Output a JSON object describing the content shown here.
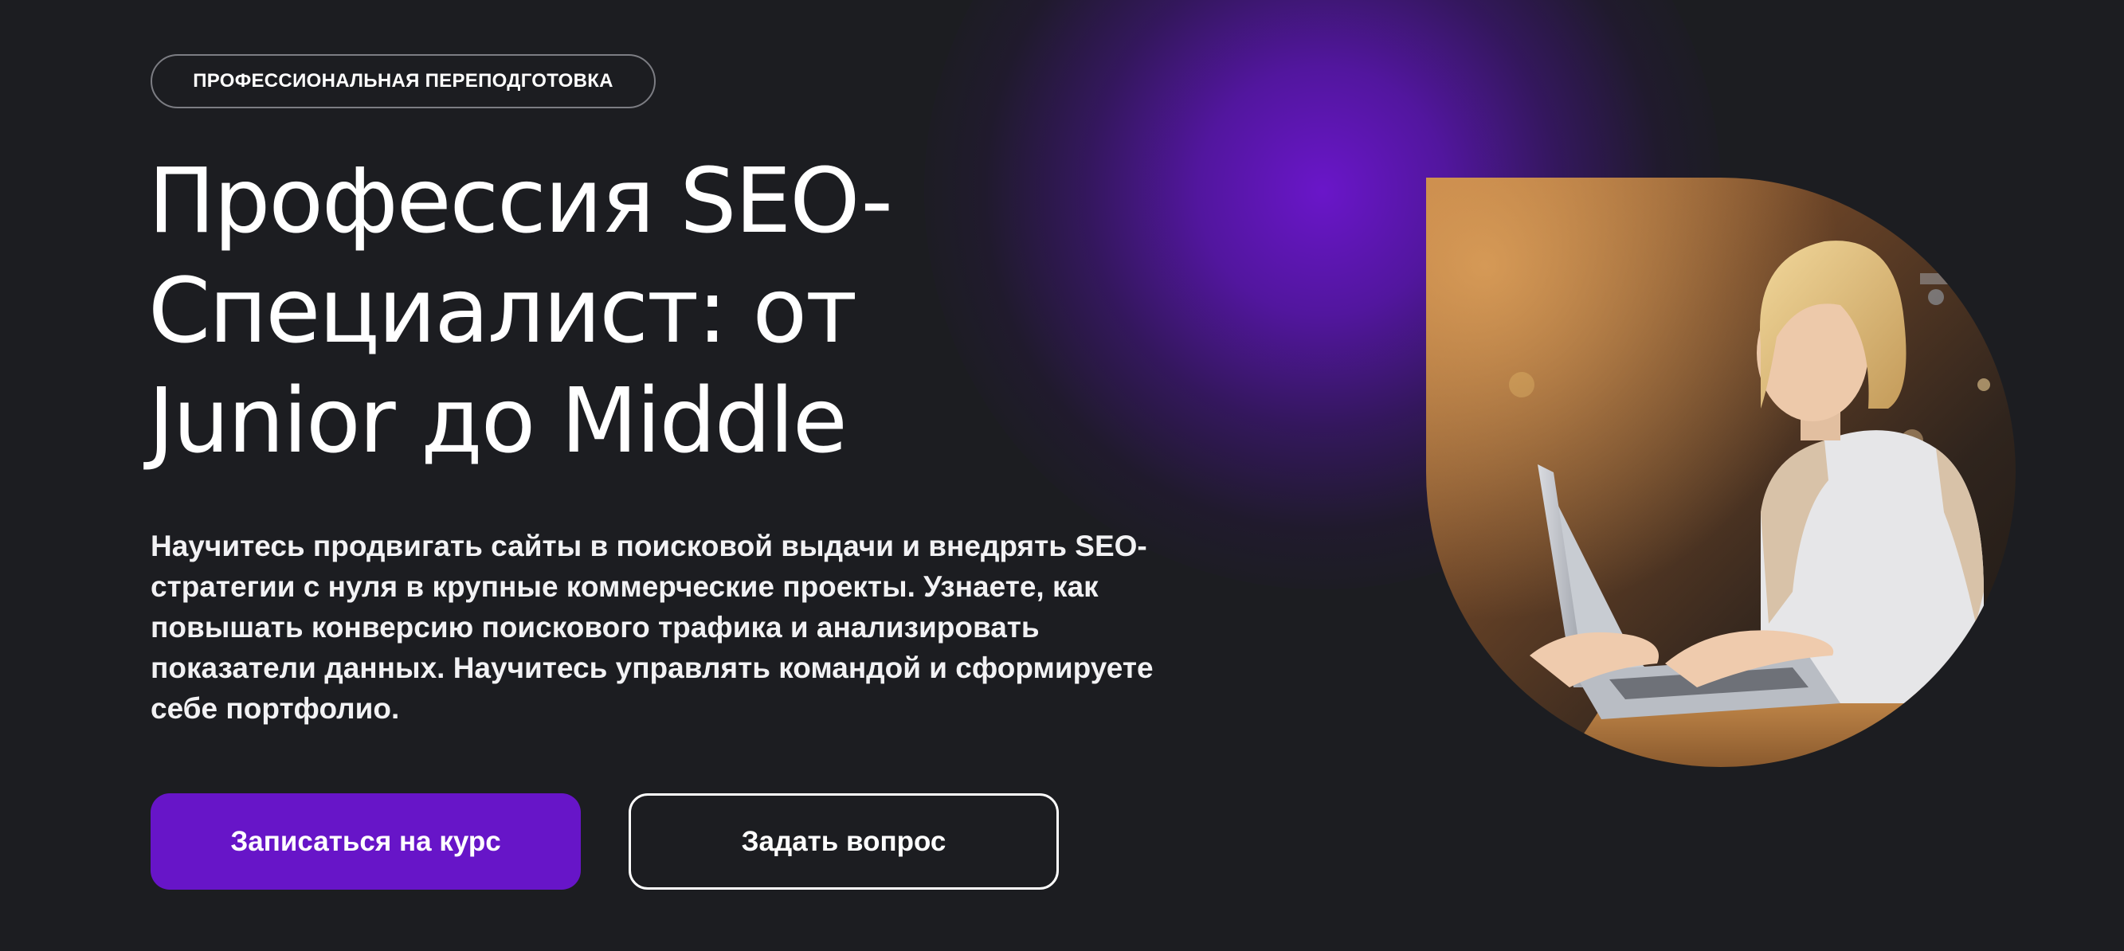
{
  "hero": {
    "badge": "ПРОФЕССИОНАЛЬНАЯ ПЕРЕПОДГОТОВКА",
    "title_lines": [
      "Профессия SEO-",
      "Специалист: от",
      "Junior до Middle"
    ],
    "description_lines": [
      "Научитесь продвигать сайты в поисковой выдачи и внедрять SEO-",
      "стратегии с нуля в крупные коммерческие проекты. Узнаете, как",
      "повышать конверсию поискового трафика и анализировать",
      "показатели данных. Научитесь управлять командой и сформируете",
      "себе портфолио."
    ],
    "primary_button": "Записаться на курс",
    "secondary_button": "Задать вопрос"
  },
  "colors": {
    "background": "#1c1d21",
    "accent": "#6715c8",
    "text": "#ffffff"
  },
  "icons": {
    "photo": "woman-with-laptop-photo"
  }
}
